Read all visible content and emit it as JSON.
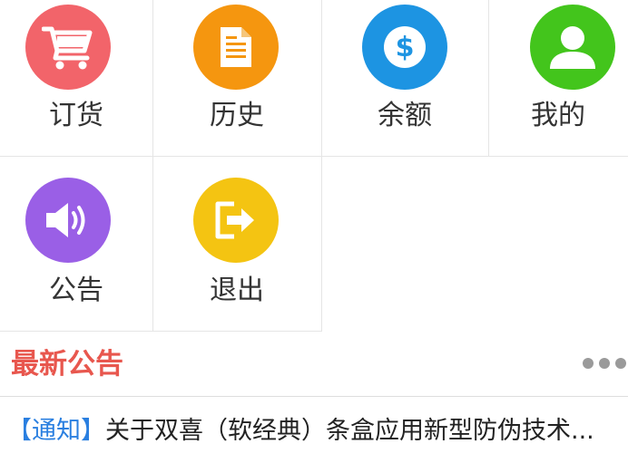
{
  "colors": {
    "cart": "#f2646a",
    "history": "#f5960f",
    "balance": "#1d94e2",
    "profile": "#43c51c",
    "notice": "#9a5fe6",
    "logout": "#f4c412",
    "section_title": "#e8574e",
    "notice_tag": "#2a7fe0"
  },
  "menu": {
    "items": [
      {
        "label": "订货",
        "icon": "cart-icon"
      },
      {
        "label": "历史",
        "icon": "document-icon"
      },
      {
        "label": "余额",
        "icon": "dollar-icon"
      },
      {
        "label": "我的",
        "icon": "user-icon"
      },
      {
        "label": "公告",
        "icon": "speaker-icon"
      },
      {
        "label": "退出",
        "icon": "exit-icon"
      }
    ]
  },
  "announcements": {
    "title": "最新公告",
    "more_icon": "more-dots-icon",
    "items": [
      {
        "tag": "【通知】",
        "text": "关于双喜（软经典）条盒应用新型防伪技术..."
      }
    ]
  }
}
